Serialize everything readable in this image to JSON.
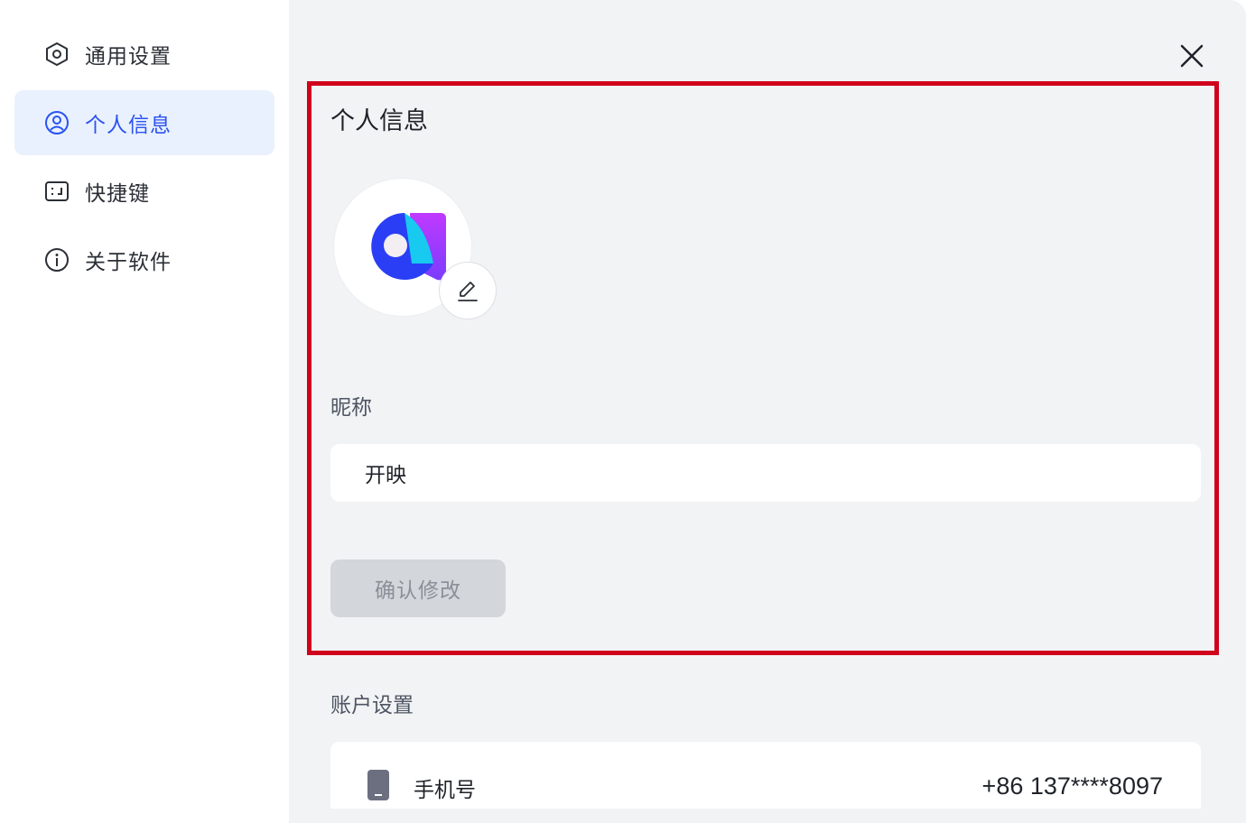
{
  "sidebar": {
    "items": [
      {
        "label": "通用设置",
        "icon": "hexagon-settings-icon",
        "active": false
      },
      {
        "label": "个人信息",
        "icon": "user-circle-icon",
        "active": true
      },
      {
        "label": "快捷键",
        "icon": "keyboard-shortcut-icon",
        "active": false
      },
      {
        "label": "关于软件",
        "icon": "info-circle-icon",
        "active": false
      }
    ]
  },
  "profile": {
    "title": "个人信息",
    "avatar_icon": "app-logo-icon",
    "nickname_label": "昵称",
    "nickname_value": "开映",
    "confirm_label": "确认修改"
  },
  "account": {
    "title": "账户设置",
    "phone_label": "手机号",
    "phone_value": "+86 137****8097"
  },
  "colors": {
    "accent": "#2b52f0",
    "active_bg": "#e9f1fe",
    "highlight_border": "#d0021b",
    "main_bg": "#f2f3f5"
  }
}
